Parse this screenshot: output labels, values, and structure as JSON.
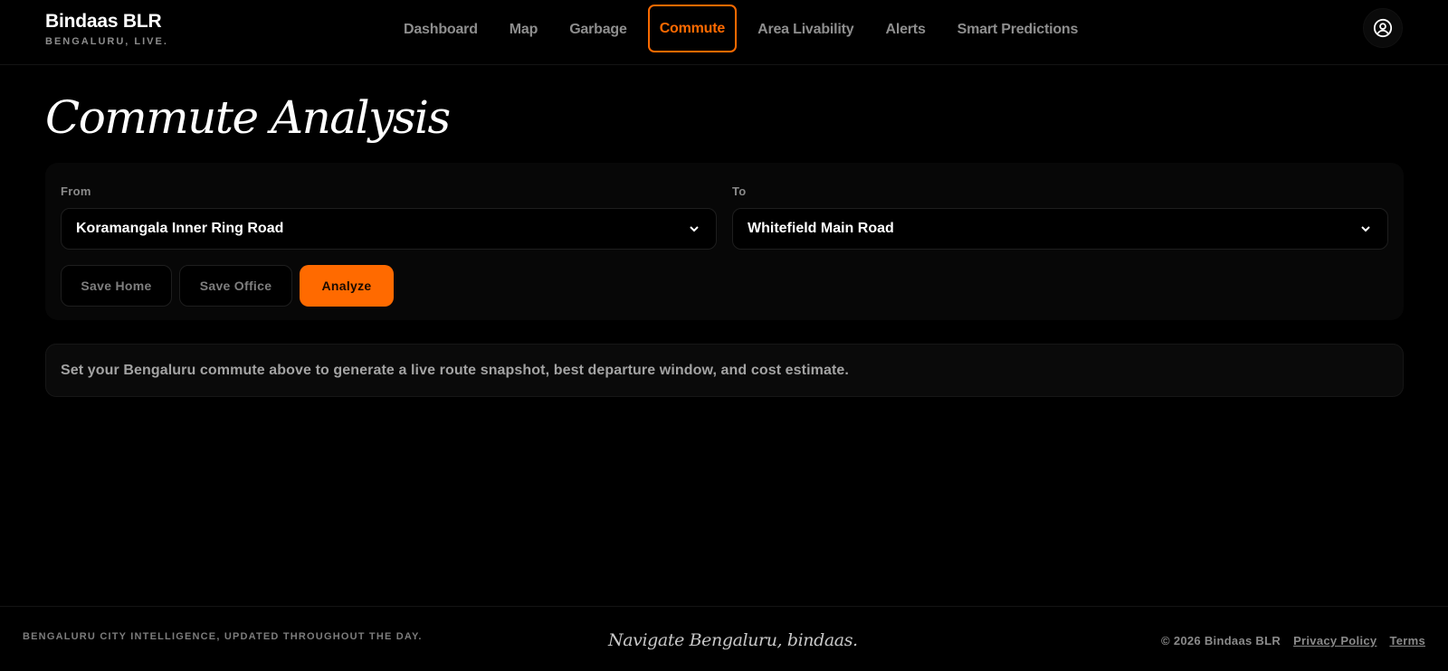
{
  "brand": {
    "name": "Bindaas BLR",
    "tagline": "BENGALURU, LIVE."
  },
  "nav": {
    "items": [
      {
        "label": "Dashboard"
      },
      {
        "label": "Map"
      },
      {
        "label": "Garbage"
      },
      {
        "label": "Commute",
        "active": true
      },
      {
        "label": "Area Livability"
      },
      {
        "label": "Alerts"
      },
      {
        "label": "Smart Predictions"
      }
    ],
    "profile_icon": "user-circle-icon"
  },
  "main": {
    "title": "Commute Analysis",
    "form": {
      "from_label": "From",
      "from_value": "Koramangala Inner Ring Road",
      "to_label": "To",
      "to_value": "Whitefield Main Road",
      "save_home_label": "Save Home",
      "save_office_label": "Save Office",
      "analyze_label": "Analyze"
    },
    "info_message": "Set your Bengaluru commute above to generate a live route snapshot, best departure window, and cost estimate."
  },
  "footer": {
    "left_text": "BENGALURU CITY INTELLIGENCE, UPDATED THROUGHOUT THE DAY.",
    "center_text": "Navigate Bengaluru, bindaas.",
    "copyright": "© 2026 Bindaas BLR",
    "links": [
      {
        "label": "Privacy Policy"
      },
      {
        "label": "Terms"
      }
    ]
  },
  "colors": {
    "accent": "#ff6a00",
    "background": "#000000",
    "card": "#070707"
  }
}
